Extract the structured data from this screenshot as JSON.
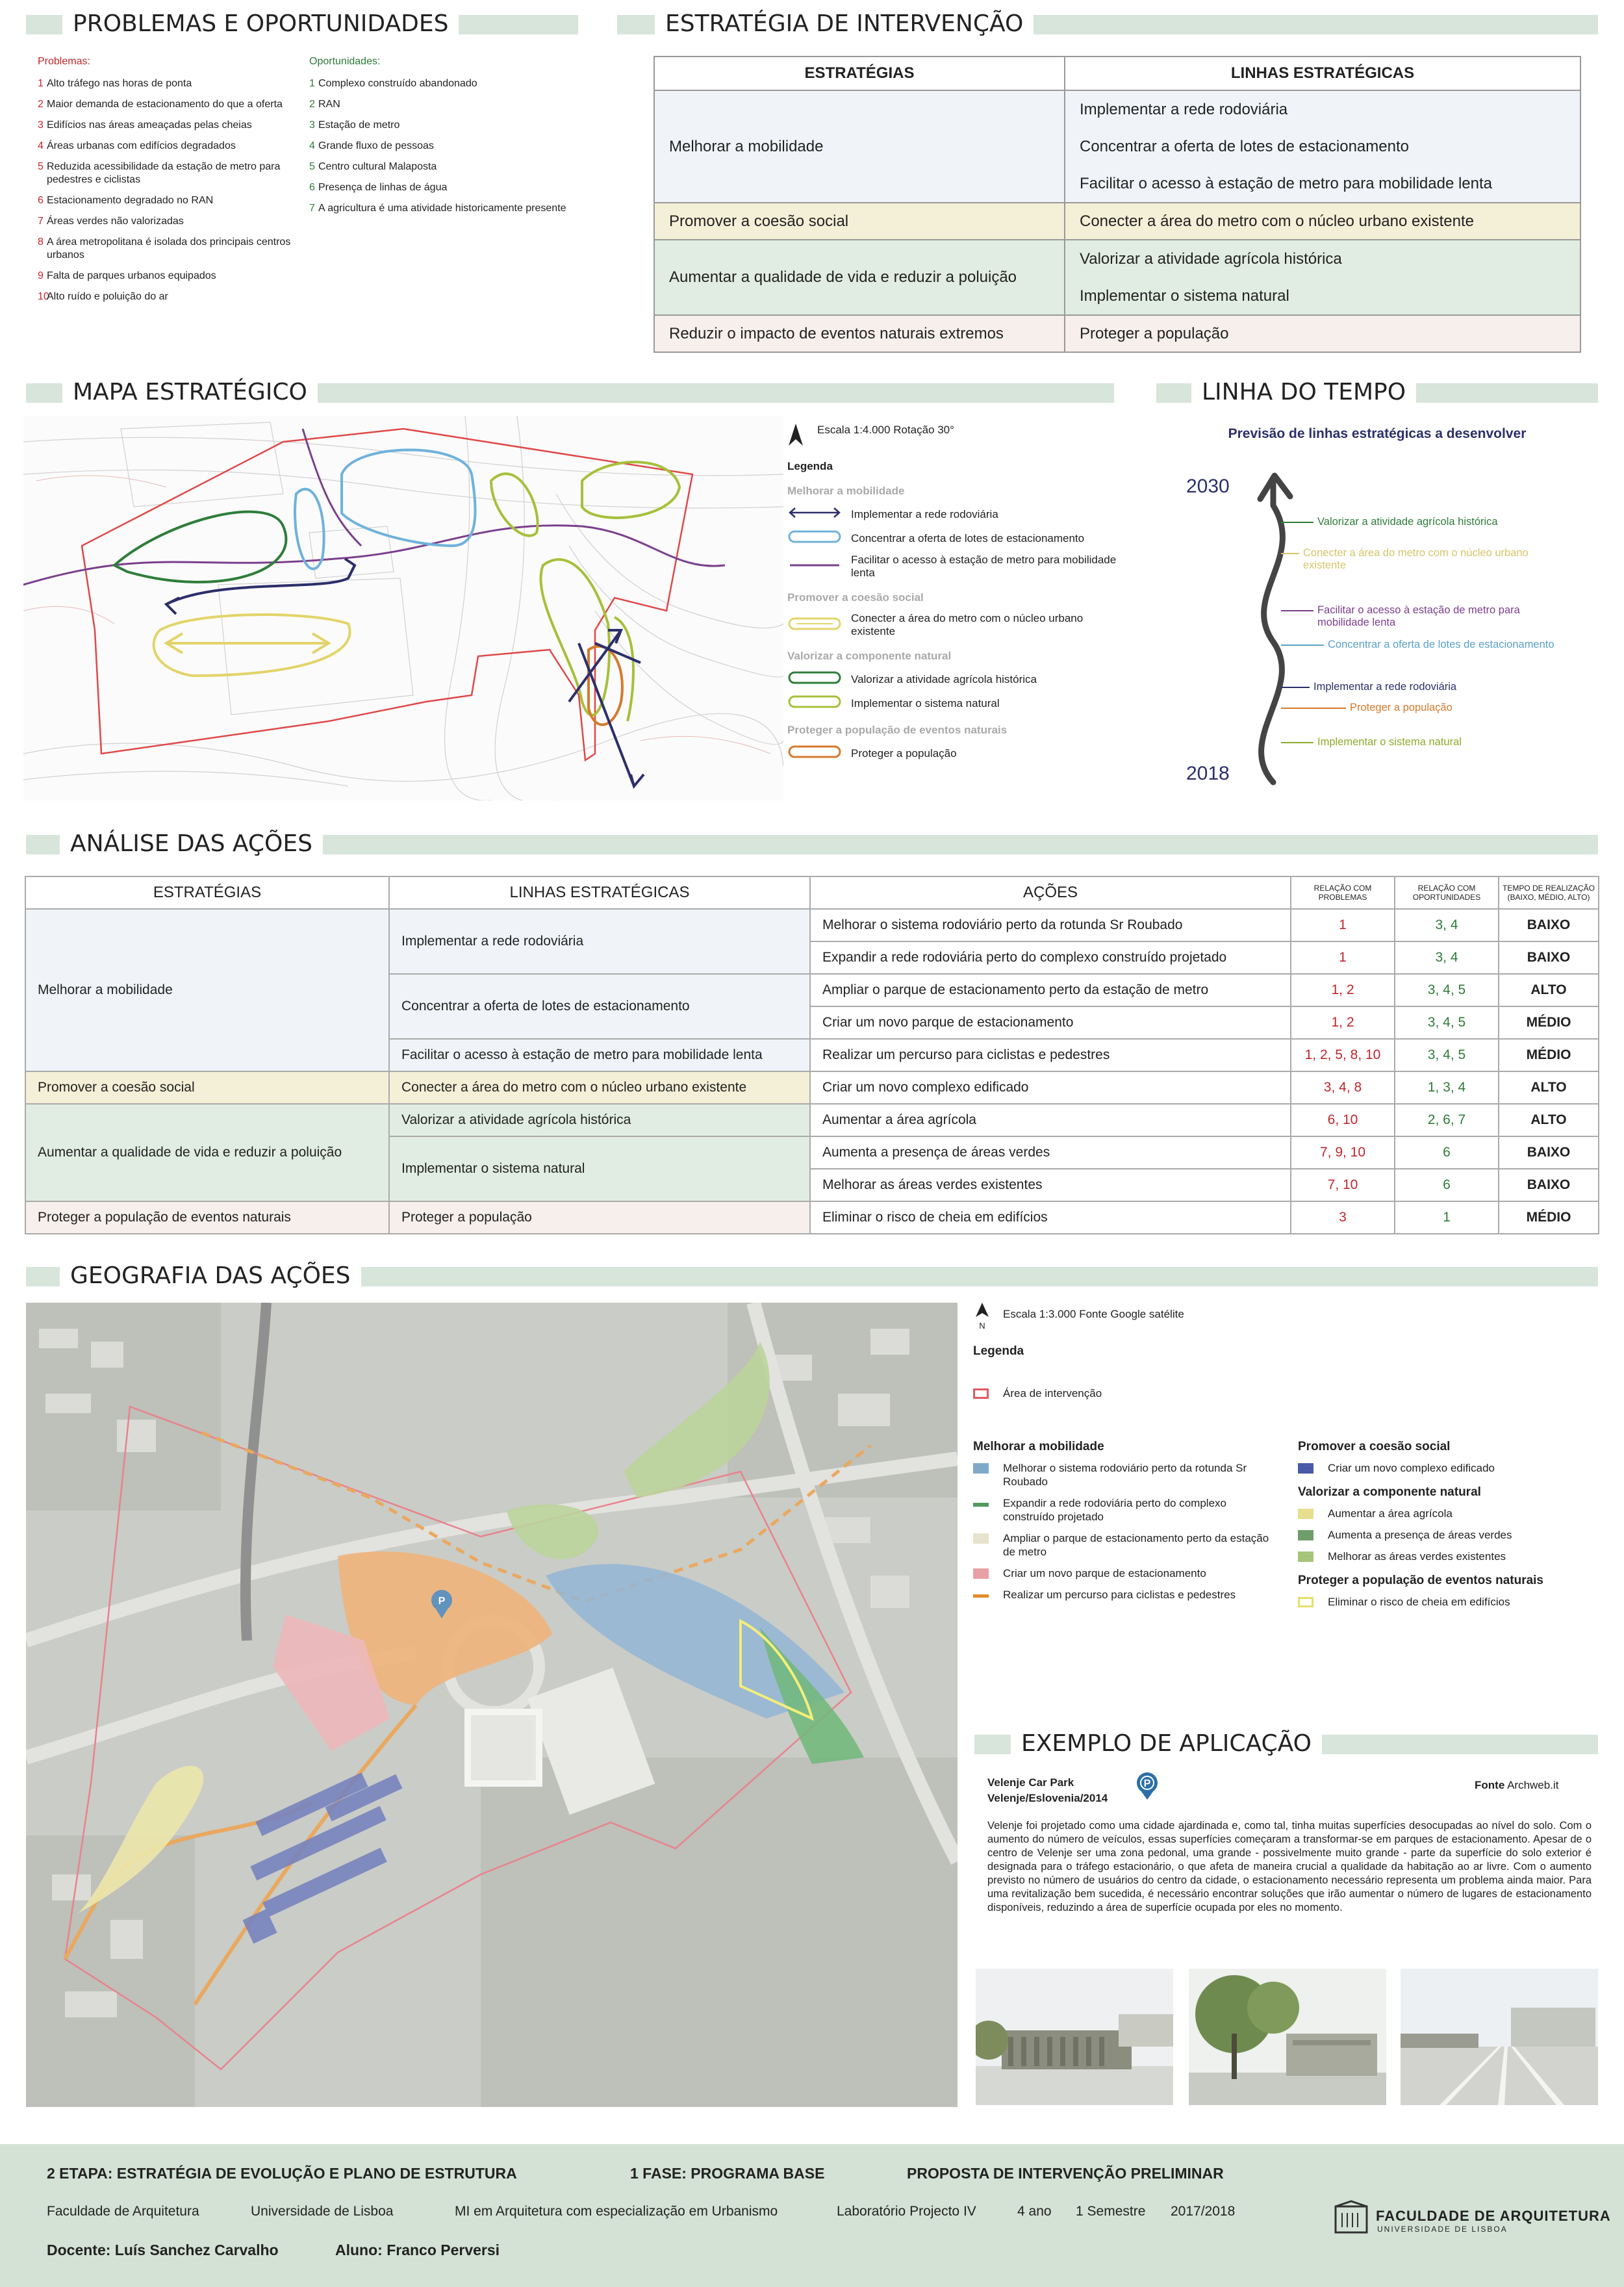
{
  "sections": {
    "problems": "PROBLEMAS E OPORTUNIDADES",
    "strategy": "ESTRATÉGIA DE INTERVENÇÃO",
    "map": "MAPA ESTRATÉGICO",
    "timeline": "LINHA DO TEMPO",
    "analysis": "ANÁLISE DAS AÇÕES",
    "geography": "GEOGRAFIA DAS AÇÕES",
    "example": "EXEMPLO DE APLICAÇÃO"
  },
  "problems": {
    "heading": "Problemas:",
    "items": [
      [
        "1",
        "Alto tráfego nas horas de ponta"
      ],
      [
        "2",
        "Maior demanda de estacionamento do que a oferta"
      ],
      [
        "3",
        "Edifícios nas áreas ameaçadas pelas cheias"
      ],
      [
        "4",
        "Áreas urbanas com edifícios degradados"
      ],
      [
        "5",
        "Reduzida acessibilidade da estação de metro para pedestres e ciclistas"
      ],
      [
        "6",
        "Estacionamento degradado no RAN"
      ],
      [
        "7",
        "Áreas verdes não valorizadas"
      ],
      [
        "8",
        "A área metropolitana é isolada dos principais centros urbanos"
      ],
      [
        "9",
        "Falta de parques urbanos equipados"
      ],
      [
        "10",
        "Alto ruído e poluição do ar"
      ]
    ]
  },
  "opportunities": {
    "heading": "Oportunidades:",
    "items": [
      [
        "1",
        "Complexo construído abandonado"
      ],
      [
        "2",
        "RAN"
      ],
      [
        "3",
        "Estação de metro"
      ],
      [
        "4",
        "Grande fluxo de pessoas"
      ],
      [
        "5",
        "Centro cultural Malaposta"
      ],
      [
        "6",
        "Presença de linhas de água"
      ],
      [
        "7",
        "A agricultura é uma atividade historicamente presente"
      ]
    ]
  },
  "strategy_table": {
    "headers": [
      "ESTRATÉGIAS",
      "LINHAS ESTRATÉGICAS"
    ],
    "rows": [
      {
        "s": "Melhorar a mobilidade",
        "l": [
          "Implementar a rede rodoviária",
          "Concentrar a oferta de lotes de estacionamento",
          "Facilitar o acesso à estação de metro para mobilidade lenta"
        ]
      },
      {
        "s": "Promover a coesão social",
        "l": [
          "Conecter a área do metro com o núcleo urbano existente"
        ]
      },
      {
        "s": "Aumentar a qualidade de vida e reduzir a poluição",
        "l": [
          "Valorizar a atividade agrícola histórica",
          "Implementar o sistema natural"
        ]
      },
      {
        "s": "Reduzir o impacto de eventos naturais extremos",
        "l": [
          "Proteger a população"
        ]
      }
    ]
  },
  "map_legend": {
    "scale": "Escala 1:4.000 Rotação 30°",
    "title": "Legenda",
    "groups": [
      {
        "h": "Melhorar a mobilidade",
        "items": [
          "Implementar a rede rodoviária",
          "Concentrar a oferta de lotes de estacionamento",
          "Facilitar o acesso à estação de metro para mobilidade lenta"
        ]
      },
      {
        "h": "Promover a coesão social",
        "items": [
          "Conecter a área do metro com o núcleo urbano existente"
        ]
      },
      {
        "h": "Valorizar a componente natural",
        "items": [
          "Valorizar a atividade agrícola histórica",
          "Implementar o sistema natural"
        ]
      },
      {
        "h": "Proteger a população de eventos naturais",
        "items": [
          "Proteger a população"
        ]
      }
    ]
  },
  "timeline": {
    "subtitle": "Previsão de linhas estratégicas a desenvolver",
    "start": "2018",
    "end": "2030",
    "items": [
      {
        "t": "Valorizar a atividade agrícola histórica",
        "c": "#2e7d3a"
      },
      {
        "t": "Conecter a área do metro com o núcleo urbano existente",
        "c": "#d6c46a"
      },
      {
        "t": "Facilitar o acesso à estação de metro para mobilidade lenta",
        "c": "#7b3f8c"
      },
      {
        "t": "Concentrar a oferta de lotes de estacionamento",
        "c": "#5aa0c8"
      },
      {
        "t": "Implementar a rede rodoviária",
        "c": "#2c2f6b"
      },
      {
        "t": "Proteger a população",
        "c": "#d47a2c"
      },
      {
        "t": "Implementar o sistema natural",
        "c": "#8eaa2a"
      }
    ]
  },
  "analysis": {
    "headers": [
      "ESTRATÉGIAS",
      "LINHAS ESTRATÉGICAS",
      "AÇÕES",
      "RELAÇÃO COM PROBLEMAS",
      "RELAÇÃO COM OPORTUNIDADES",
      "TEMPO DE REALIZAÇÃO (BAIXO, MÉDIO, ALTO)"
    ],
    "strategies": [
      "Melhorar a mobilidade",
      "Promover a coesão social",
      "Aumentar a qualidade de vida e reduzir a poluição",
      "Proteger a população de eventos naturais"
    ],
    "lines": [
      "Implementar a rede rodoviária",
      "Concentrar a oferta de lotes de estacionamento",
      "Facilitar o acesso à estação de metro para mobilidade lenta",
      "Conecter a área do metro com o núcleo urbano existente",
      "Valorizar a atividade agrícola histórica",
      "Implementar o sistema natural",
      "Proteger a população"
    ],
    "rows": [
      [
        "Melhorar o sistema rodoviário perto da rotunda Sr Roubado",
        "1",
        "3, 4",
        "BAIXO"
      ],
      [
        "Expandir a rede rodoviária perto do complexo construído projetado",
        "1",
        "3, 4",
        "BAIXO"
      ],
      [
        "Ampliar o parque de estacionamento perto da estação de metro",
        "1, 2",
        "3, 4, 5",
        "ALTO"
      ],
      [
        "Criar um novo parque de estacionamento",
        "1, 2",
        "3, 4, 5",
        "MÉDIO"
      ],
      [
        "Realizar um percurso para ciclistas e pedestres",
        "1, 2, 5, 8, 10",
        "3, 4, 5",
        "MÉDIO"
      ],
      [
        "Criar um novo complexo edificado",
        "3, 4, 8",
        "1, 3, 4",
        "ALTO"
      ],
      [
        "Aumentar a área agrícola",
        "6, 10",
        "2, 6, 7",
        "ALTO"
      ],
      [
        "Aumenta a presença de áreas verdes",
        "7, 9, 10",
        "6",
        "BAIXO"
      ],
      [
        "Melhorar as áreas verdes existentes",
        "7, 10",
        "6",
        "BAIXO"
      ],
      [
        "Eliminar o risco de cheia em edifícios",
        "3",
        "1",
        "MÉDIO"
      ]
    ]
  },
  "geo_legend": {
    "scale": "Escala 1:3.000 Fonte Google satélite",
    "title": "Legenda",
    "area": "Área de intervenção",
    "mob_h": "Melhorar a mobilidade",
    "mob": [
      {
        "t": "Melhorar o sistema rodoviário perto da rotunda Sr Roubado",
        "c": "#7fa9c9"
      },
      {
        "t": "Expandir a rede rodoviária perto do complexo construído projetado",
        "c": "#4f9a5f"
      },
      {
        "t": "Ampliar o parque de estacionamento perto da estação de metro",
        "c": "#e7e3cc"
      },
      {
        "t": "Criar um novo parque de estacionamento",
        "c": "#e8a0a4"
      },
      {
        "t": "Realizar um percurso para ciclistas e pedestres",
        "c": "#e38b2a"
      }
    ],
    "coh_h": "Promover a coesão social",
    "coh": [
      {
        "t": "Criar um novo complexo edificado",
        "c": "#4a5aa8"
      }
    ],
    "nat_h": "Valorizar a componente natural",
    "nat": [
      {
        "t": "Aumentar a área agrícola",
        "c": "#e6df8f"
      },
      {
        "t": "Aumenta a presença de áreas verdes",
        "c": "#6f9e6a"
      },
      {
        "t": "Melhorar as áreas verdes existentes",
        "c": "#a5c57a"
      }
    ],
    "prot_h": "Proteger a população de eventos naturais",
    "prot": [
      {
        "t": "Eliminar o risco de cheia em edifícios",
        "c": "#efefb0"
      }
    ]
  },
  "example": {
    "name": "Velenje Car Park",
    "place": "Velenje/Eslovenia/2014",
    "source_label": "Fonte",
    "source": "Archweb.it",
    "text": "Velenje foi projetado como uma cidade ajardinada e, como tal, tinha muitas superfícies desocupadas ao nível do solo. Com o aumento do número de veículos, essas superfícies começaram a transformar-se em parques de estacionamento. Apesar de o centro de Velenje ser uma zona pedonal, uma grande - possivelmente muito grande - parte da superfície do solo exterior é designada para o tráfego estacionário, o que afeta de maneira crucial a qualidade da habitação ao ar livre. Com o aumento previsto no número de usuários do centro da cidade, o estacionamento necessário representa um problema ainda maior. Para uma revitalização bem sucedida, é necessário encontrar soluções que irão aumentar o número de lugares de estacionamento disponíveis, reduzindo a área de superfície ocupada por eles no momento."
  },
  "footer": {
    "stage": "2 ETAPA: ESTRATÉGIA DE EVOLUÇÃO E PLANO DE ESTRUTURA",
    "phase": "1 FASE: PROGRAMA BASE",
    "proposal": "PROPOSTA DE INTERVENÇÃO PRELIMINAR",
    "faculty": "Faculdade de Arquitetura",
    "university": "Universidade de Lisboa",
    "course": "MI em Arquitetura com especialização em Urbanismo",
    "lab": "Laboratório Projecto IV",
    "year": "4 ano",
    "semester": "1 Semestre",
    "period": "2017/2018",
    "teacher": "Docente: Luís Sanchez Carvalho",
    "student": "Aluno: Franco Perversi",
    "logo": "FACULDADE DE ARQUITETURA",
    "logo_sub": "UNIVERSIDADE DE LISBOA"
  }
}
